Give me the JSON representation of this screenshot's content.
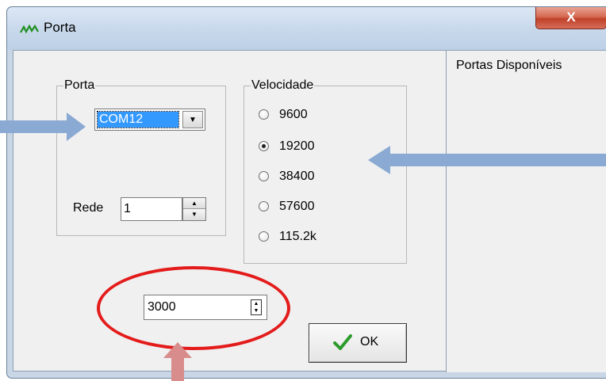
{
  "window": {
    "title": "Porta",
    "close_label": "X",
    "icon": "waveform-icon"
  },
  "porta_group": {
    "legend": "Porta",
    "combo_value": "COM12",
    "rede_label": "Rede",
    "rede_value": "1"
  },
  "velocidade_group": {
    "legend": "Velocidade",
    "options": [
      {
        "label": "9600",
        "checked": false
      },
      {
        "label": "19200",
        "checked": true
      },
      {
        "label": "38400",
        "checked": false
      },
      {
        "label": "57600",
        "checked": false
      },
      {
        "label": "115.2k",
        "checked": false
      }
    ]
  },
  "timeout_value": "3000",
  "ok_button": {
    "label": "OK",
    "icon": "checkmark-icon"
  },
  "right_panel": {
    "title": "Portas Disponíveis"
  },
  "colors": {
    "arrow_blue": "#8aa9d3",
    "arrow_pink": "#d98c8c",
    "highlight_red": "#e41b1b",
    "selection_blue": "#3399ff"
  }
}
